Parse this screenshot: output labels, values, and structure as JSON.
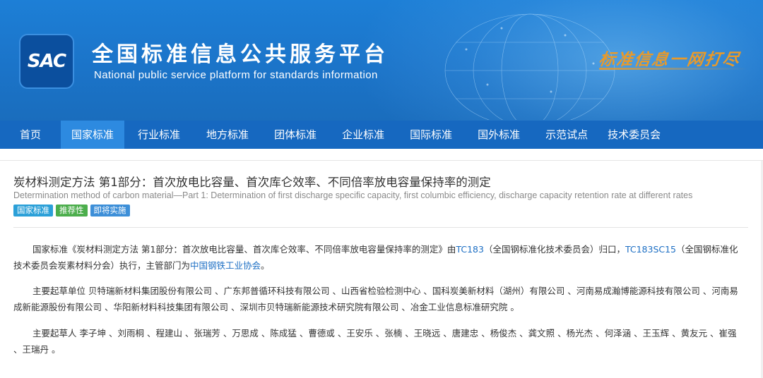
{
  "header": {
    "logo_text": "SAC",
    "title": "全国标准信息公共服务平台",
    "subtitle": "National public service platform  for standards information",
    "slogan": "标准信息一网打尽"
  },
  "nav": {
    "items": [
      "首页",
      "国家标准",
      "行业标准",
      "地方标准",
      "团体标准",
      "企业标准",
      "国际标准",
      "国外标准",
      "示范试点",
      "技术委员会"
    ],
    "active": "国家标准"
  },
  "standard": {
    "title": "炭材料测定方法 第1部分：首次放电比容量、首次库仑效率、不同倍率放电容量保持率的测定",
    "title_en": "Determination method of carbon material—Part 1: Determination of first discharge specific capacity, first columbic efficiency, discharge capacity retention rate at different rates",
    "badges": [
      "国家标准",
      "推荐性",
      "即将实施"
    ]
  },
  "intro": {
    "part1": "国家标准《炭材料测定方法 第1部分：首次放电比容量、首次库仑效率、不同倍率放电容量保持率的测定》由",
    "tc_link": "TC183",
    "part2": "（全国钢标准化技术委员会）归口，",
    "subtc_link": "TC183SC15",
    "part3": "（全国钢标准化技术委员会炭素材料分会）执行，主管部门为",
    "dept_link": "中国钢铁工业协会",
    "part4": "。"
  },
  "drafting_units": {
    "label": "主要起草单位",
    "text": "贝特瑞新材料集团股份有限公司 、广东邦普循环科技有限公司 、山西省检验检测中心 、国科炭美新材料（湖州）有限公司 、河南易成瀚博能源科技有限公司 、河南易成新能源股份有限公司 、华阳新材料科技集团有限公司 、深圳市贝特瑞新能源技术研究院有限公司 、冶金工业信息标准研究院 。"
  },
  "drafters": {
    "label": "主要起草人",
    "text": "李子坤 、刘雨桐 、程建山 、张瑞芳 、万思成 、陈成猛 、曹德或 、王安乐 、张楠 、王晓远 、唐建忠 、杨俊杰 、龚文照 、杨光杰 、何泽涵 、王玉辉 、黄友元 、崔强 、王瑞丹 。"
  },
  "colors": {
    "banner": "#1b74c9",
    "nav": "#1668c0",
    "nav_active": "#2d8ae0",
    "link": "#1d6fc4",
    "slogan": "#e89a2a"
  }
}
